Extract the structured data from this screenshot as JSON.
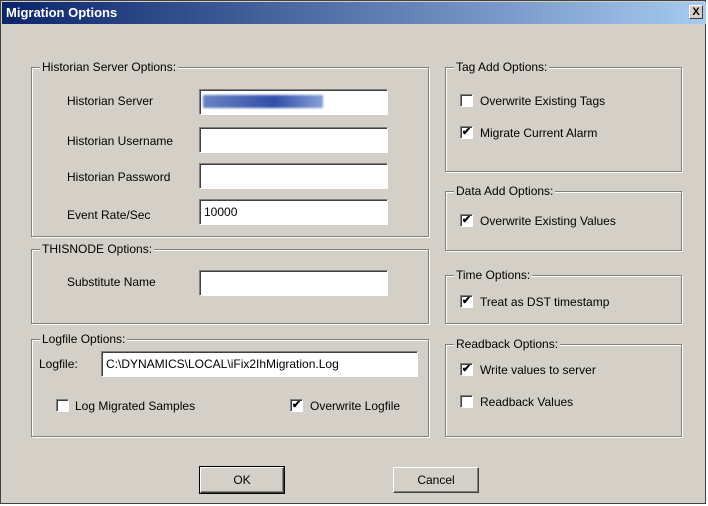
{
  "window": {
    "title": "Migration Options",
    "close_glyph": "X"
  },
  "historian": {
    "legend": "Historian Server Options:",
    "server_label": "Historian Server",
    "username_label": "Historian Username",
    "password_label": "Historian Password",
    "event_rate_label": "Event Rate/Sec",
    "event_rate_value": "10000"
  },
  "thisnode": {
    "legend": "THISNODE Options:",
    "substitute_label": "Substitute Name"
  },
  "logfile": {
    "legend": "Logfile Options:",
    "logfile_label": "Logfile:",
    "logfile_value": "C:\\DYNAMICS\\LOCAL\\iFix2IhMigration.Log",
    "log_migrated_label": "Log Migrated Samples",
    "log_migrated_checked": false,
    "overwrite_label": "Overwrite Logfile",
    "overwrite_checked": true
  },
  "tag_add": {
    "legend": "Tag Add Options:",
    "overwrite_tags_label": "Overwrite Existing Tags",
    "overwrite_tags_checked": false,
    "migrate_alarm_label": "Migrate Current Alarm",
    "migrate_alarm_checked": true
  },
  "data_add": {
    "legend": "Data Add Options:",
    "overwrite_values_label": "Overwrite Existing Values",
    "overwrite_values_checked": true
  },
  "time": {
    "legend": "Time Options:",
    "dst_label": "Treat as DST timestamp",
    "dst_checked": true
  },
  "readback": {
    "legend": "Readback Options:",
    "write_label": "Write values to server",
    "write_checked": true,
    "readback_label": "Readback Values",
    "readback_checked": false
  },
  "buttons": {
    "ok": "OK",
    "cancel": "Cancel"
  },
  "check_glyph": "✔"
}
